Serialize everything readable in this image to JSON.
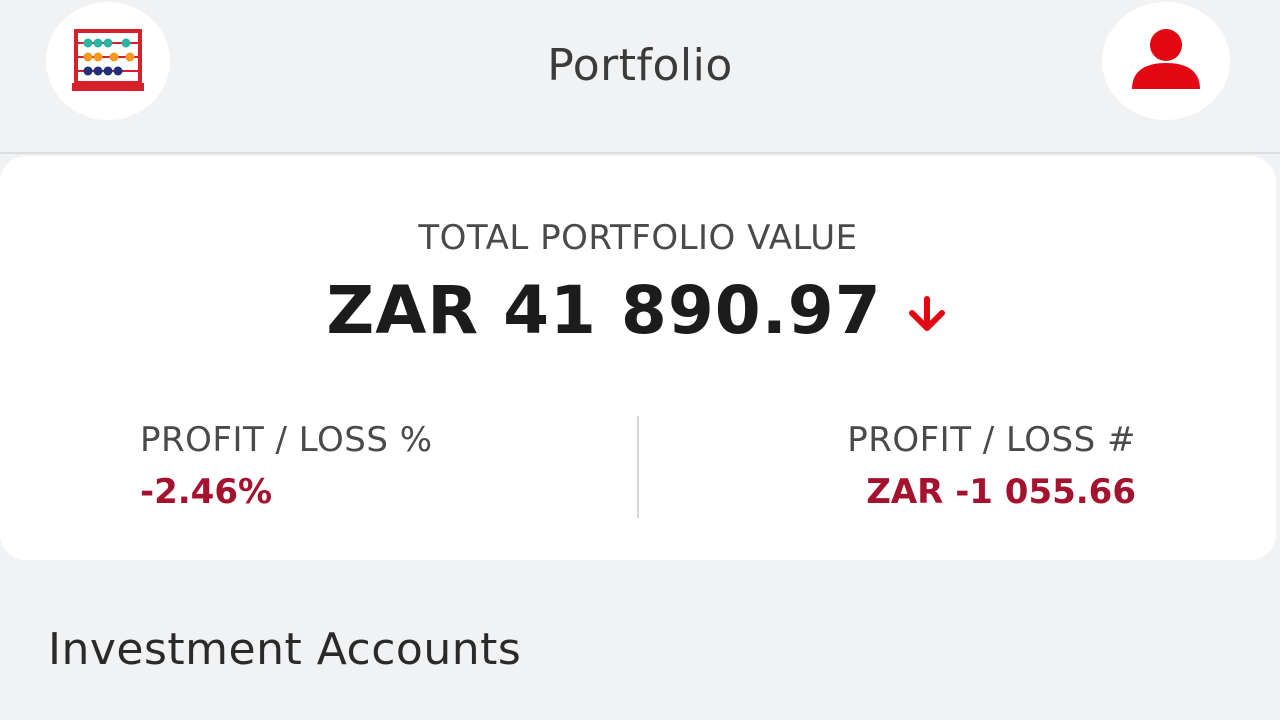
{
  "header": {
    "title": "Portfolio",
    "left_icon": "abacus-icon",
    "right_icon": "user-profile-icon"
  },
  "summary": {
    "total_label": "TOTAL PORTFOLIO VALUE",
    "total_value": "ZAR 41 890.97",
    "trend_icon": "arrow-down-icon",
    "profit_loss_percent_label": "PROFIT / LOSS %",
    "profit_loss_percent_value": "-2.46%",
    "profit_loss_amount_label": "PROFIT / LOSS #",
    "profit_loss_amount_value": "ZAR -1 055.66"
  },
  "sections": {
    "investment_accounts_title": "Investment Accounts"
  },
  "colors": {
    "accent_red": "#e30613",
    "loss_text": "#a5122e",
    "background": "#f1f2f4"
  }
}
